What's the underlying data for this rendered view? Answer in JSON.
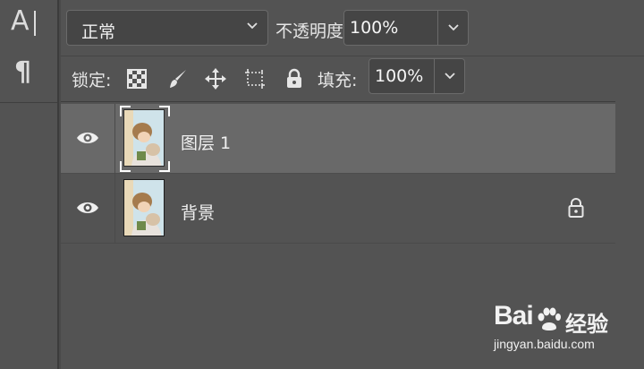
{
  "toolstrip": {
    "tools": [
      {
        "name": "character-tool",
        "glyph": "A"
      },
      {
        "name": "paragraph-tool",
        "glyph": "¶"
      }
    ]
  },
  "layers_panel": {
    "blend_mode": "正常",
    "opacity_label": "不透明度:",
    "opacity_value": "100%",
    "lock_label": "锁定:",
    "lock_icons": [
      "lock-transparent-pixels-icon",
      "lock-image-pixels-icon",
      "lock-position-icon",
      "lock-artboard-icon",
      "lock-all-icon"
    ],
    "fill_label": "填充:",
    "fill_value": "100%",
    "layers": [
      {
        "name": "图层 1",
        "visible": true,
        "selected": true,
        "locked": false
      },
      {
        "name": "背景",
        "visible": true,
        "selected": false,
        "locked": true
      }
    ]
  },
  "watermark": {
    "brand_latin": "Bai",
    "brand_cn": "经验",
    "url": "jingyan.baidu.com"
  },
  "colors": {
    "panel_bg": "#535353",
    "selected_row": "#696969",
    "field_bg": "#454545"
  }
}
